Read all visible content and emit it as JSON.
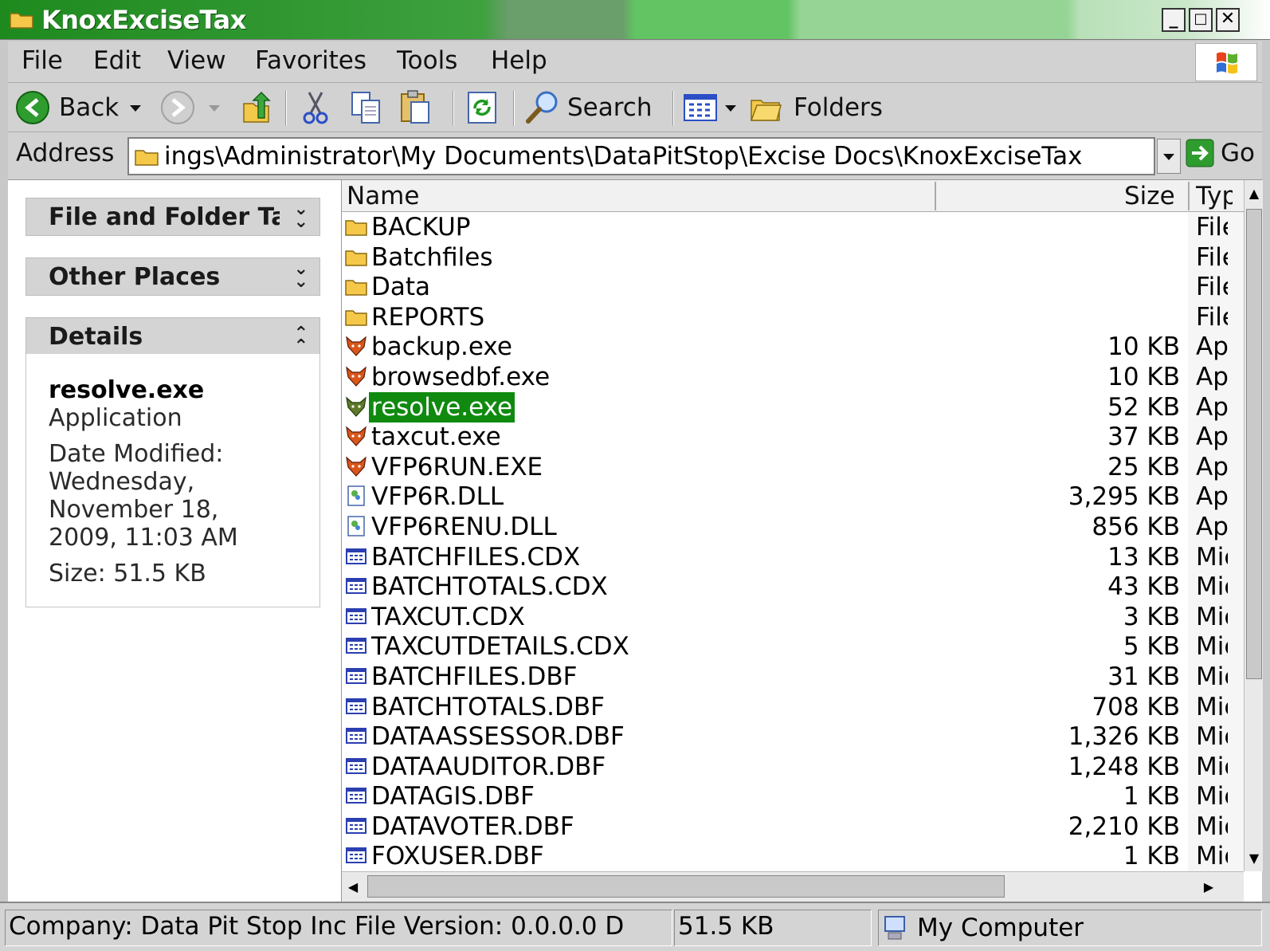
{
  "window": {
    "title": "KnoxExciseTax",
    "minimize": "_",
    "maximize": "□",
    "close": "✕"
  },
  "menu": {
    "items": [
      {
        "label": "File"
      },
      {
        "label": "Edit"
      },
      {
        "label": "View"
      },
      {
        "label": "Favorites"
      },
      {
        "label": "Tools"
      },
      {
        "label": "Help"
      }
    ]
  },
  "toolbar": {
    "back": "Back",
    "search": "Search",
    "folders": "Folders"
  },
  "address": {
    "label": "Address",
    "value": "ings\\Administrator\\My Documents\\DataPitStop\\Excise Docs\\KnoxExciseTax",
    "go": "Go"
  },
  "tasks": {
    "file_folder_tasks": "File and Folder Tasks",
    "other_places": "Other Places",
    "details": "Details"
  },
  "details": {
    "name": "resolve.exe",
    "type": "Application",
    "date_label": "Date Modified:",
    "date_line1": "Wednesday,",
    "date_line2": "November 18,",
    "date_line3": "2009, 11:03 AM",
    "size": "Size: 51.5 KB"
  },
  "columns": {
    "name": "Name",
    "size": "Size",
    "type": "Type"
  },
  "files": [
    {
      "name": "BACKUP",
      "size": "",
      "type": "File Folder",
      "icon": "folder-icon"
    },
    {
      "name": "Batchfiles",
      "size": "",
      "type": "File Folder",
      "icon": "folder-icon"
    },
    {
      "name": "Data",
      "size": "",
      "type": "File Folder",
      "icon": "folder-icon"
    },
    {
      "name": "REPORTS",
      "size": "",
      "type": "File Folder",
      "icon": "folder-icon"
    },
    {
      "name": "backup.exe",
      "size": "10 KB",
      "type": "Application",
      "icon": "fox-app-icon"
    },
    {
      "name": "browsedbf.exe",
      "size": "10 KB",
      "type": "Application",
      "icon": "fox-app-icon"
    },
    {
      "name": "resolve.exe",
      "size": "52 KB",
      "type": "Application",
      "icon": "fox-app-icon",
      "selected": true
    },
    {
      "name": "taxcut.exe",
      "size": "37 KB",
      "type": "Application",
      "icon": "fox-app-icon"
    },
    {
      "name": "VFP6RUN.EXE",
      "size": "25 KB",
      "type": "Application",
      "icon": "fox-app-icon"
    },
    {
      "name": "VFP6R.DLL",
      "size": "3,295 KB",
      "type": "Application Extension",
      "icon": "dll-icon"
    },
    {
      "name": "VFP6RENU.DLL",
      "size": "856 KB",
      "type": "Application Extension",
      "icon": "dll-icon"
    },
    {
      "name": "BATCHFILES.CDX",
      "size": "13 KB",
      "type": "Microsoft Visual FoxPro Index",
      "icon": "table-file-icon"
    },
    {
      "name": "BATCHTOTALS.CDX",
      "size": "43 KB",
      "type": "Microsoft Visual FoxPro Index",
      "icon": "table-file-icon"
    },
    {
      "name": "TAXCUT.CDX",
      "size": "3 KB",
      "type": "Microsoft Visual FoxPro Index",
      "icon": "table-file-icon"
    },
    {
      "name": "TAXCUTDETAILS.CDX",
      "size": "5 KB",
      "type": "Microsoft Visual FoxPro Index",
      "icon": "table-file-icon"
    },
    {
      "name": "BATCHFILES.DBF",
      "size": "31 KB",
      "type": "Microsoft Visual FoxPro Table",
      "icon": "table-file-icon"
    },
    {
      "name": "BATCHTOTALS.DBF",
      "size": "708 KB",
      "type": "Microsoft Visual FoxPro Table",
      "icon": "table-file-icon"
    },
    {
      "name": "DATAASSESSOR.DBF",
      "size": "1,326 KB",
      "type": "Microsoft Visual FoxPro Table",
      "icon": "table-file-icon"
    },
    {
      "name": "DATAAUDITOR.DBF",
      "size": "1,248 KB",
      "type": "Microsoft Visual FoxPro Table",
      "icon": "table-file-icon"
    },
    {
      "name": "DATAGIS.DBF",
      "size": "1 KB",
      "type": "Microsoft Visual FoxPro Table",
      "icon": "table-file-icon"
    },
    {
      "name": "DATAVOTER.DBF",
      "size": "2,210 KB",
      "type": "Microsoft Visual FoxPro Table",
      "icon": "table-file-icon"
    },
    {
      "name": "FOXUSER.DBF",
      "size": "1 KB",
      "type": "Microsoft Visual FoxPro Table",
      "icon": "table-file-icon"
    }
  ],
  "status": {
    "info": "Company: Data Pit Stop Inc File Version: 0.0.0.0 D",
    "size": "51.5 KB",
    "zone": "My Computer"
  },
  "colors": {
    "title_green": "#1e8a1e",
    "selection": "#0f8a0f"
  }
}
